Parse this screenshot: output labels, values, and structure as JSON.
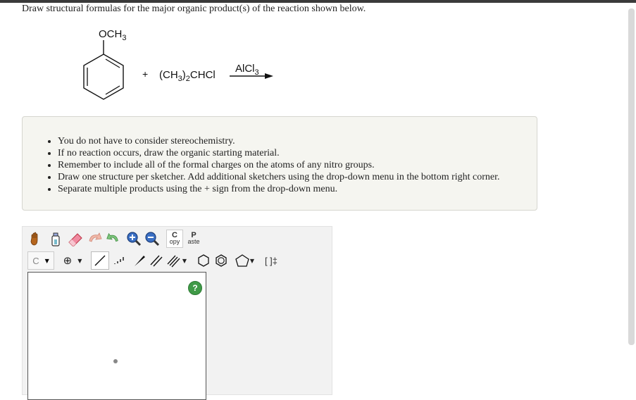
{
  "question": "Draw structural formulas for the major organic product(s) of the reaction shown below.",
  "reaction": {
    "substituent": "OCH",
    "substituent_sub": "3",
    "plus": "+",
    "reagent_a": "(CH",
    "reagent_sub1": "3",
    "reagent_b": ")",
    "reagent_sub2": "2",
    "reagent_c": "CHCl",
    "catalyst": "AlCl",
    "catalyst_sub": "3"
  },
  "notes": [
    "You do not have to consider stereochemistry.",
    "If no reaction occurs, draw the organic starting material.",
    "Remember to include all of the formal charges on the atoms of any nitro groups.",
    "Draw one structure per sketcher. Add additional sketchers using the drop-down menu in the bottom right corner.",
    "Separate multiple products using the + sign from the drop-down menu."
  ],
  "toolbar": {
    "copy_top": "C",
    "copy_bottom": "opy",
    "paste_top": "P",
    "paste_bottom": "aste",
    "atom_label": "C",
    "charge_label": "⊕",
    "bracket_label": "[ ]‡",
    "help_label": "?"
  }
}
